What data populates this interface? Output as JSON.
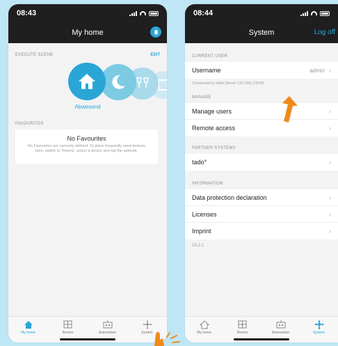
{
  "left": {
    "status_time": "08:43",
    "title": "My home",
    "execute_scene_label": "EXECUTE SCENE",
    "edit_label": "EDIT",
    "scene_name": "Abwesend",
    "favourites_label": "FAVOURITES",
    "fav_title": "No Favourites",
    "fav_text": "No Favourites are currently defined. To place frequently used devices here, switch to 'Rooms', select a device and tap the asterisk.",
    "tabs": [
      "My home",
      "Rooms",
      "Automation",
      "System"
    ]
  },
  "right": {
    "status_time": "08:44",
    "title": "System",
    "logoff": "Log off",
    "current_user_label": "CURRENT USER",
    "username_label": "Username",
    "username_value": "admin",
    "connected_text": "Connected to eNet Server 192.168.178.59",
    "manage_label": "MANAGE",
    "manage_items": [
      "Manage users",
      "Remote access"
    ],
    "partner_label": "PARTNER SYSTEMS",
    "partner_items": [
      "tado°"
    ],
    "information_label": "INFORMATION",
    "information_items": [
      "Data protection declaration",
      "Licenses",
      "Imprint"
    ],
    "version": "V2.2.1",
    "tabs": [
      "My home",
      "Rooms",
      "Automation",
      "System"
    ]
  },
  "colors": {
    "accent": "#2aa6d6",
    "header": "#1f1f20",
    "arrow": "#f08a1c",
    "background": "#bfe6f4"
  }
}
